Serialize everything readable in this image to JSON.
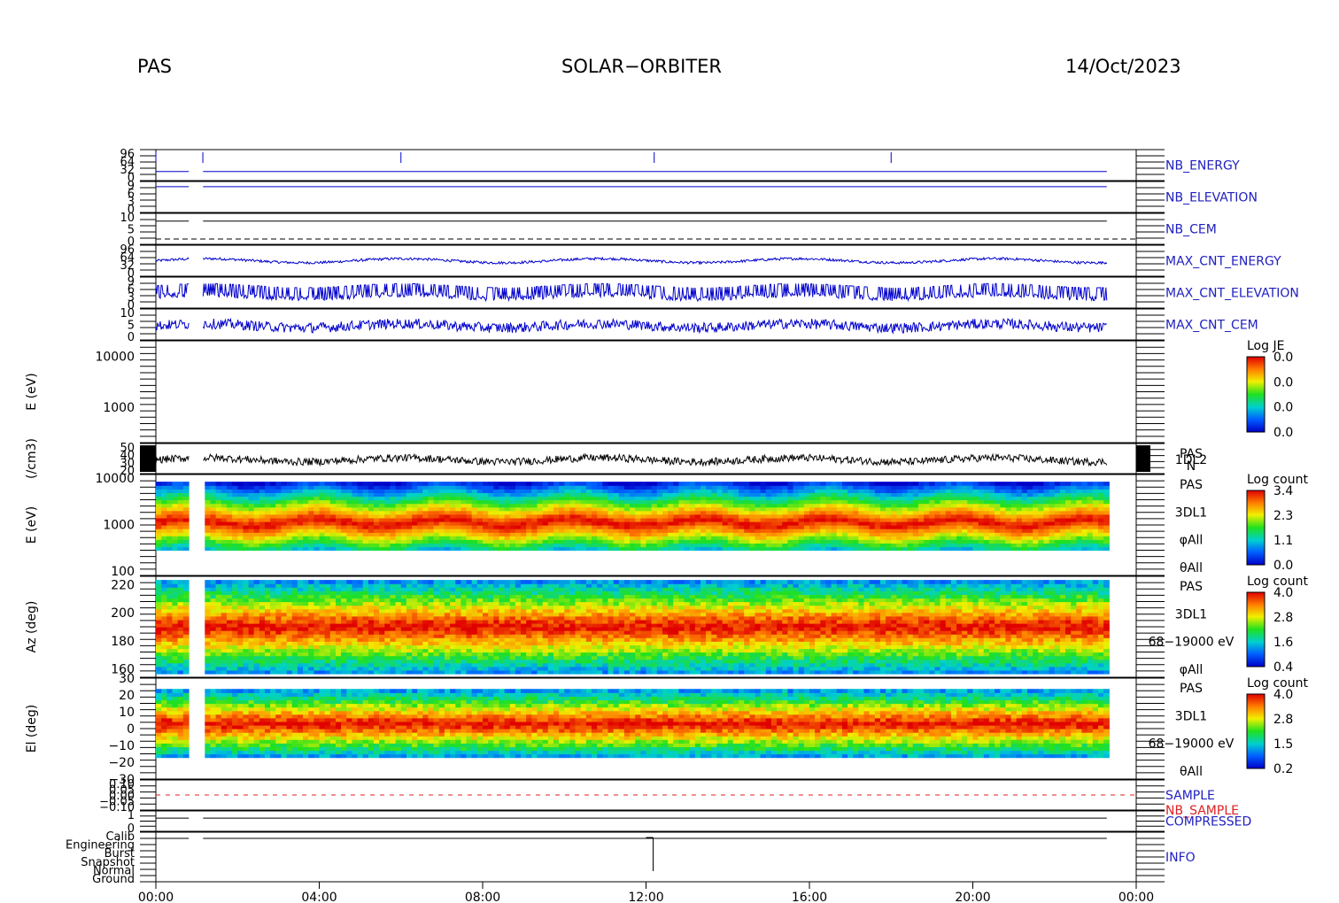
{
  "header": {
    "instrument": "PAS",
    "mission": "SOLAR−ORBITER",
    "date": "14/Oct/2023"
  },
  "colors": {
    "trace_blue": "#0000cc",
    "trace_black": "#000000",
    "label_blue": "#2020c0",
    "label_red": "#e02020"
  },
  "chart_data": {
    "type": "heatmap",
    "x_axis": {
      "unit": "hours",
      "range": [
        0,
        24
      ],
      "tick_labels": [
        "00:00",
        "04:00",
        "08:00",
        "12:00",
        "16:00",
        "20:00",
        "00:00"
      ],
      "tick_values": [
        0,
        4,
        8,
        12,
        16,
        20,
        24
      ]
    },
    "panels": [
      {
        "key": "nb_energy",
        "label": "NB_ENERGY",
        "label_color": "label",
        "tick_labels": [
          "96",
          "64",
          "32",
          "0"
        ],
        "trace": "blue",
        "base": 0.25,
        "spikes_hours": [
          0.0,
          1.15,
          6.0,
          12.2,
          18.0
        ]
      },
      {
        "key": "nb_elevation",
        "label": "NB_ELEVATION",
        "tick_labels": [
          "9",
          "6",
          "3",
          "0"
        ],
        "trace": "blue",
        "base": 0.9
      },
      {
        "key": "nb_cem",
        "label": "NB_CEM",
        "tick_labels": [
          "10",
          "5",
          "0"
        ],
        "trace": "black",
        "base": 0.8,
        "dashed_zero": true
      },
      {
        "key": "max_cnt_energy",
        "label": "MAX_CNT_ENERGY",
        "tick_labels": [
          "96",
          "64",
          "32",
          "0"
        ],
        "trace": "blue",
        "base": 0.5,
        "noise": 0.05
      },
      {
        "key": "max_cnt_elevation",
        "label": "MAX_CNT_ELEVATION",
        "tick_labels": [
          "9",
          "6",
          "3",
          "0"
        ],
        "trace": "blue",
        "base": 0.35,
        "noise": 0.35,
        "square": true
      },
      {
        "key": "max_cnt_cem",
        "label": "MAX_CNT_CEM",
        "tick_labels": [
          "10",
          "5",
          "0"
        ],
        "trace": "blue",
        "base": 0.45,
        "noise": 0.2
      },
      {
        "key": "e_ev_1dl2",
        "ylabel": "E (eV)",
        "tick_labels": [
          "10000",
          "1000"
        ],
        "tick_values": [
          10000,
          1000
        ],
        "log": true,
        "yrange": [
          200,
          20000
        ],
        "colorbar": {
          "title": "Log JE",
          "ticks": [
            "0.0",
            "0.0",
            "0.0",
            "0.0"
          ]
        }
      },
      {
        "key": "density",
        "ylabel": "(/cm3)",
        "tick_labels": [
          "50",
          "40",
          "30",
          "20"
        ],
        "trace": "black",
        "side_labels": [
          "PAS",
          "1DL2",
          "N"
        ],
        "base": 0.45,
        "noise": 0.15
      },
      {
        "key": "e_ev_3dl1",
        "ylabel": "E (eV)",
        "tick_labels": [
          "10000",
          "1000",
          "100"
        ],
        "tick_values": [
          10000,
          1000,
          100
        ],
        "log": true,
        "yrange": [
          80,
          12000
        ],
        "side_labels": [
          "PAS",
          "3DL1",
          "φAll",
          "θAll"
        ],
        "colorbar": {
          "title": "Log count",
          "ticks": [
            "3.4",
            "2.3",
            "1.1",
            "0.0"
          ]
        },
        "band_center_log": 3.05,
        "band_low_log": 2.45,
        "band_high_log": 3.95
      },
      {
        "key": "azimuth",
        "ylabel": "Az (deg)",
        "tick_labels": [
          "220",
          "200",
          "180",
          "160"
        ],
        "tick_values": [
          220,
          200,
          180,
          160
        ],
        "yrange": [
          154,
          226
        ],
        "side_labels": [
          "PAS",
          "3DL1",
          "68−19000 eV",
          "φAll"
        ],
        "colorbar": {
          "title": "Log count",
          "ticks": [
            "4.0",
            "2.8",
            "1.6",
            "0.4"
          ]
        },
        "data_range": [
          156,
          224
        ]
      },
      {
        "key": "elevation",
        "ylabel": "El (deg)",
        "tick_labels": [
          "30",
          "20",
          "10",
          "0",
          "−10",
          "−20",
          "−30"
        ],
        "tick_values": [
          30,
          20,
          10,
          0,
          -10,
          -20,
          -30
        ],
        "yrange": [
          -30,
          30
        ],
        "side_labels": [
          "PAS",
          "3DL1",
          "68−19000 eV",
          "θAll"
        ],
        "colorbar": {
          "title": "Log count",
          "ticks": [
            "4.0",
            "2.8",
            "1.5",
            "0.2"
          ]
        },
        "data_range": [
          -18,
          24
        ]
      },
      {
        "key": "sample",
        "label": "SAMPLE",
        "label2": "NB_SAMPLE",
        "tick_labels": [
          "0.10",
          "0.05",
          "0.00",
          "−0.05",
          "−0.10"
        ]
      },
      {
        "key": "compressed",
        "label": "COMPRESSED",
        "tick_labels": [
          "1",
          "0"
        ],
        "trace": "black",
        "base": 0.7
      },
      {
        "key": "info",
        "label": "INFO",
        "tick_labels": [
          "Calib",
          "Engineering",
          "Burst",
          "Snapshot",
          "Normal",
          "Ground"
        ],
        "trace": "black"
      }
    ],
    "data_gaps_hours": [
      [
        0.82,
        1.14
      ]
    ],
    "data_end_hour": 23.3,
    "event_hour": 12.0
  }
}
